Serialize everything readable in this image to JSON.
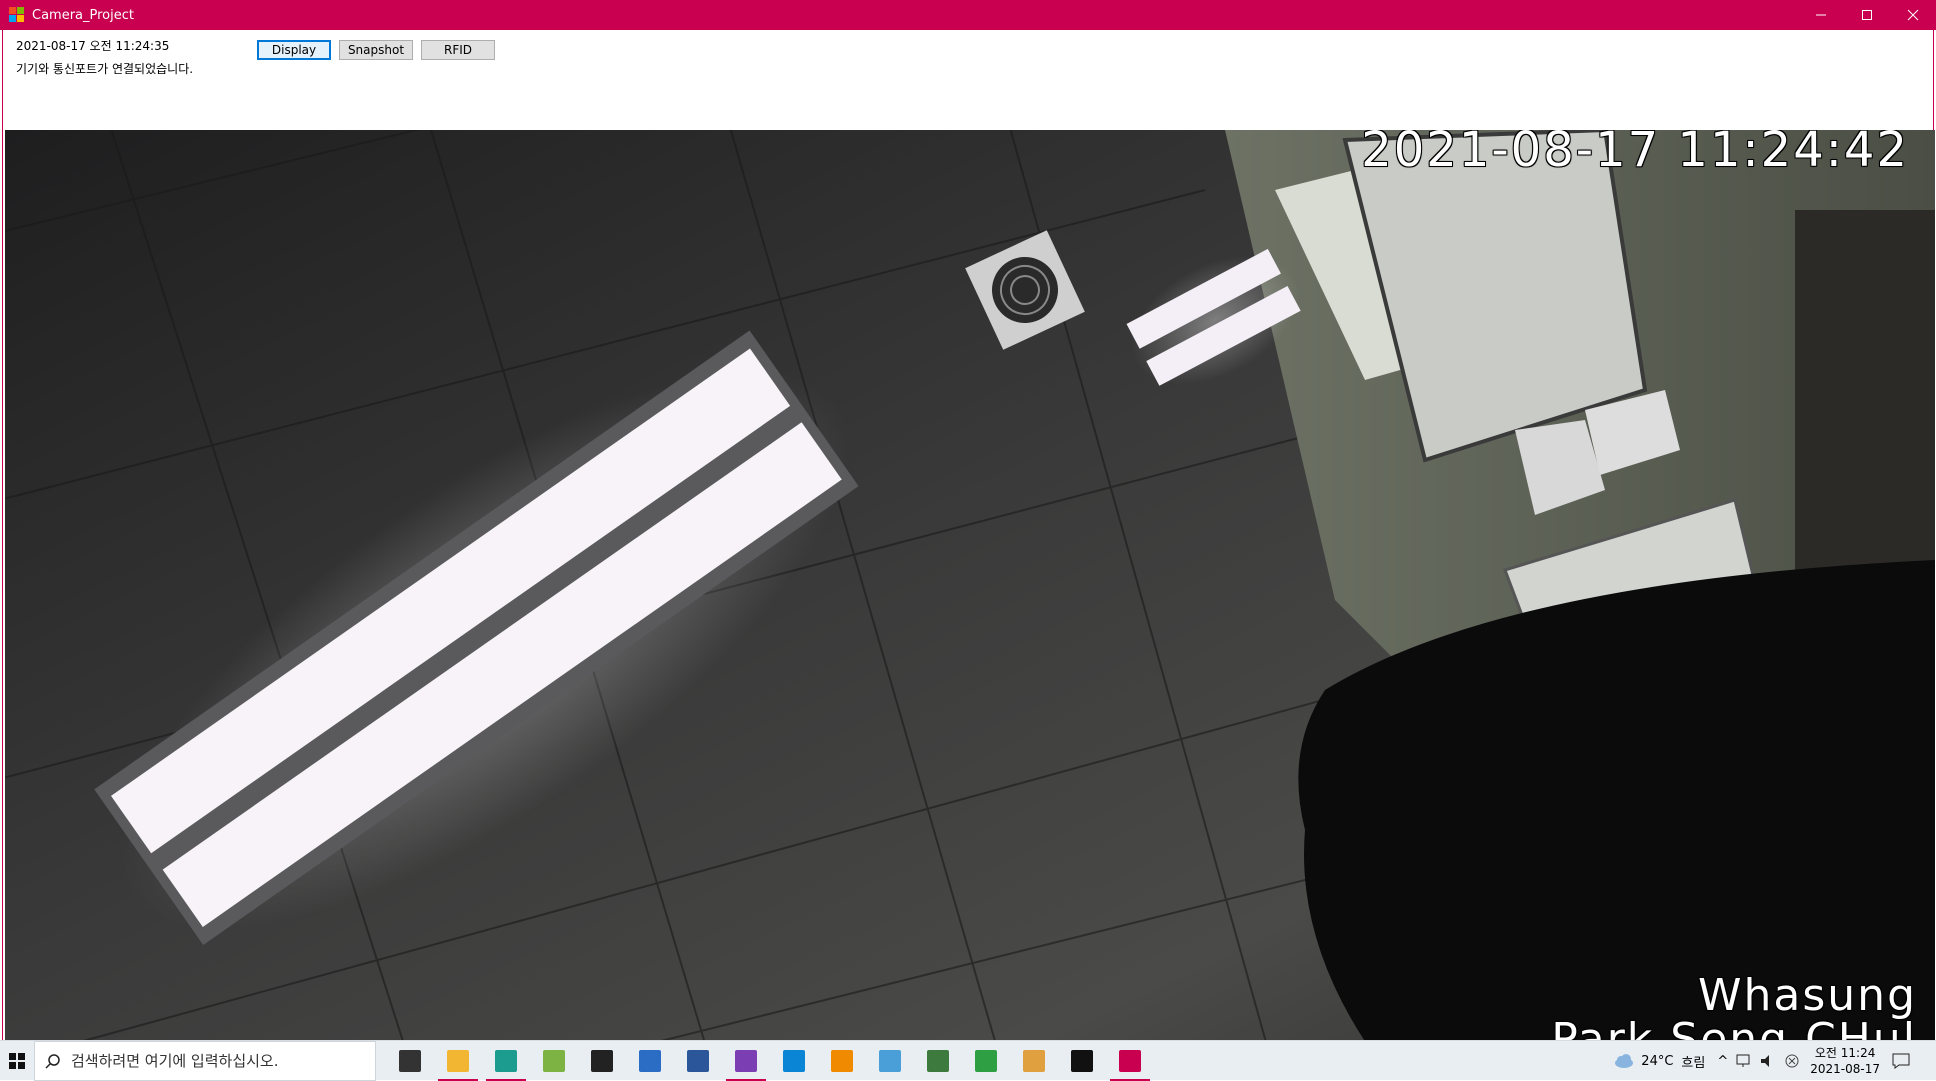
{
  "window": {
    "title": "Camera_Project",
    "controls": {
      "minimize": "—",
      "maximize": "☐",
      "close": "✕"
    }
  },
  "status": {
    "datetime": "2021-08-17 오전 11:24:35",
    "message": "기기와 통신포트가 연결되었습니다."
  },
  "toolbar": {
    "display_label": "Display",
    "snapshot_label": "Snapshot",
    "rfid_label": "RFID"
  },
  "camera": {
    "timestamp": "2021-08-17 11:24:42",
    "company": "Whasung",
    "operator": "Park Seng CHul"
  },
  "taskbar": {
    "search_placeholder": "검색하려면 여기에 입력하십시오.",
    "apps": [
      {
        "name": "task-view-icon",
        "color": "#333333"
      },
      {
        "name": "file-explorer-icon",
        "color": "#f2b632",
        "active": true
      },
      {
        "name": "edge-icon",
        "color": "#1b9c8f",
        "active": true
      },
      {
        "name": "notepad-plus-icon",
        "color": "#7cb342"
      },
      {
        "name": "sticky-notes-icon",
        "color": "#222222"
      },
      {
        "name": "powershell-icon",
        "color": "#2b6cc4"
      },
      {
        "name": "word-icon",
        "color": "#2b579a"
      },
      {
        "name": "visual-studio-icon",
        "color": "#7b3fb3",
        "active": true
      },
      {
        "name": "vscode-icon",
        "color": "#0a84d4"
      },
      {
        "name": "vlc-icon",
        "color": "#f08a00"
      },
      {
        "name": "network-tool-icon",
        "color": "#4a9fd8"
      },
      {
        "name": "hs-app-icon",
        "color": "#3d7a3d"
      },
      {
        "name": "excel-like-icon",
        "color": "#2ea043"
      },
      {
        "name": "folder-tool-icon",
        "color": "#e0a040"
      },
      {
        "name": "terminal-icon",
        "color": "#111111"
      },
      {
        "name": "camera-project-taskbar-icon",
        "color": "#c8004f",
        "active": true
      }
    ],
    "weather": {
      "temp": "24°C",
      "desc": "흐림"
    },
    "clock": {
      "time": "오전 11:24",
      "date": "2021-08-17"
    }
  }
}
